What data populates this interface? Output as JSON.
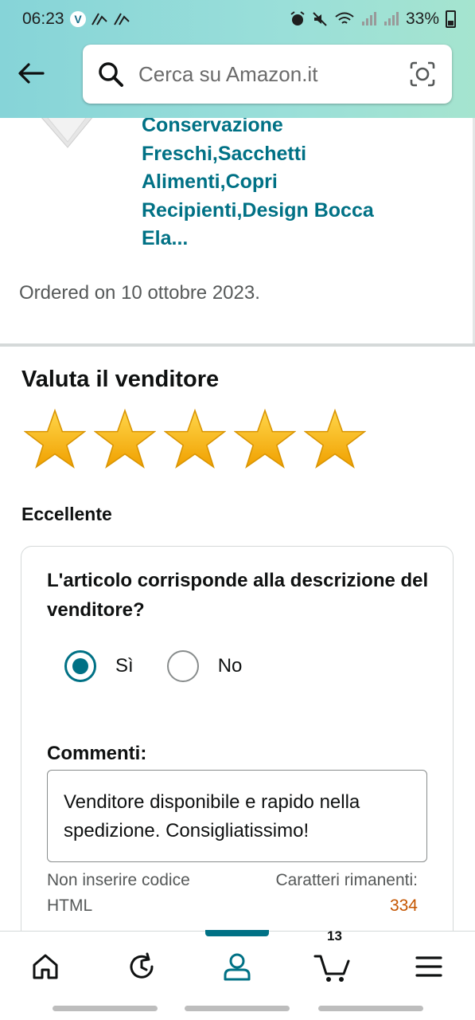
{
  "status_bar": {
    "time": "06:23",
    "battery": "33%"
  },
  "header": {
    "search_placeholder": "Cerca su Amazon.it"
  },
  "product": {
    "title_lines": [
      "Conservazione",
      "Freschi,Sacchetti",
      "Alimenti,Copri",
      "Recipienti,Design Bocca",
      "Ela..."
    ],
    "ordered": "Ordered on 10 ottobre 2023."
  },
  "rating": {
    "title": "Valuta il venditore",
    "stars": 5,
    "max_stars": 5,
    "label": "Eccellente"
  },
  "feedback": {
    "question": "L'articolo corrisponde alla descrizione del venditore?",
    "yes_label": "Sì",
    "no_label": "No",
    "selected": "Sì",
    "comments_label": "Commenti:",
    "comment_text": "Venditore disponibile e rapido nella spedizione. Consigliatissimo!",
    "hint_text": "Non inserire codice HTML",
    "remaining_label": "Caratteri rimanenti:",
    "remaining_count": "334"
  },
  "bottom_nav": {
    "cart_count": "13",
    "active": "account"
  },
  "colors": {
    "accent": "#007185",
    "star": "#f7b500",
    "counter": "#c45500"
  }
}
